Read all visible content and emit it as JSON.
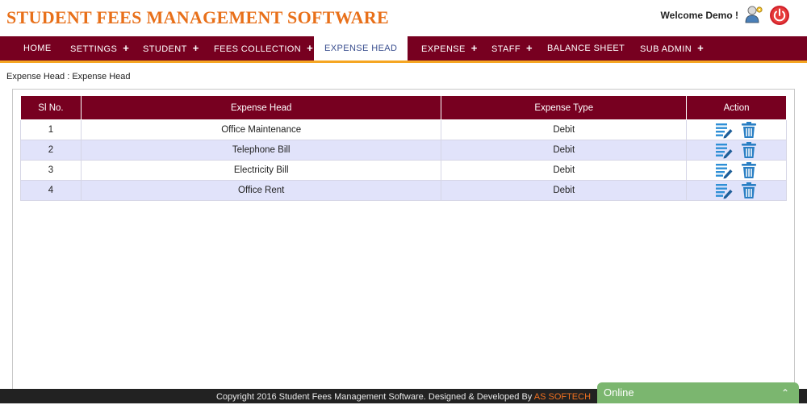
{
  "header": {
    "title": "STUDENT FEES MANAGEMENT SOFTWARE",
    "welcome": "Welcome Demo !"
  },
  "nav": {
    "items": [
      {
        "label": "HOME",
        "plus": ""
      },
      {
        "label": "SETTINGS",
        "plus": "+"
      },
      {
        "label": "STUDENT",
        "plus": "+"
      },
      {
        "label": "FEES COLLECTION",
        "plus": "+"
      },
      {
        "label": "EXPENSE HEAD",
        "plus": ""
      },
      {
        "label": "EXPENSE",
        "plus": "+"
      },
      {
        "label": "STAFF",
        "plus": "+"
      },
      {
        "label": "BALANCE SHEET",
        "plus": ""
      },
      {
        "label": "SUB ADMIN",
        "plus": "+"
      }
    ]
  },
  "breadcrumb": "Expense Head : Expense Head",
  "table": {
    "headers": [
      "Sl No.",
      "Expense Head",
      "Expense Type",
      "Action"
    ],
    "rows": [
      {
        "sl": "1",
        "head": "Office Maintenance",
        "type": "Debit"
      },
      {
        "sl": "2",
        "head": "Telephone Bill",
        "type": "Debit"
      },
      {
        "sl": "3",
        "head": "Electricity Bill",
        "type": "Debit"
      },
      {
        "sl": "4",
        "head": "Office Rent",
        "type": "Debit"
      }
    ]
  },
  "footer": {
    "text": "Copyright 2016 Student Fees Management Software. Designed & Developed By ",
    "brand": "AS SOFTECH"
  },
  "chat": {
    "label": "Online",
    "chevron": "⌃"
  },
  "colors": {
    "brand_orange": "#e8701a",
    "nav_maroon": "#770020",
    "nav_underline": "#f5a623",
    "row_alt": "#e1e3fa",
    "chat_green": "#7bb66f"
  }
}
